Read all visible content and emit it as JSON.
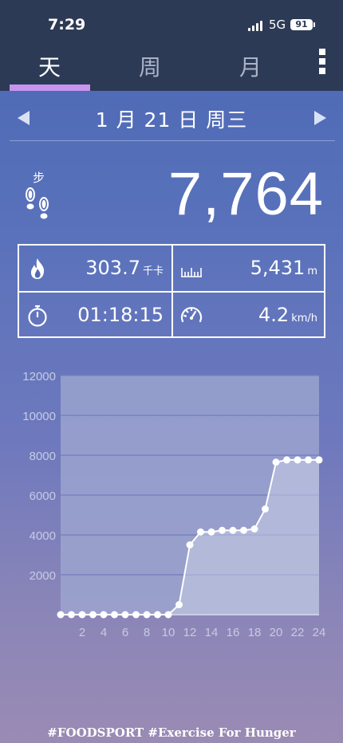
{
  "status_bar": {
    "time": "7:29",
    "network": "5G",
    "battery": "91"
  },
  "tabs": [
    {
      "label": "天",
      "active": true
    },
    {
      "label": "周",
      "active": false
    },
    {
      "label": "月",
      "active": false
    }
  ],
  "date": {
    "label": "1 月 21 日 周三"
  },
  "steps": {
    "label": "步",
    "value": "7,764"
  },
  "stats": {
    "calories": {
      "value": "303.7",
      "unit": "千卡",
      "icon": "flame-icon"
    },
    "distance": {
      "value": "5,431",
      "unit": "m",
      "icon": "ruler-icon"
    },
    "duration": {
      "value": "01:18:15",
      "icon": "stopwatch-icon"
    },
    "speed": {
      "value": "4.2",
      "unit": "km/h",
      "icon": "speedometer-icon"
    }
  },
  "chart_data": {
    "type": "line",
    "x": [
      0,
      1,
      2,
      3,
      4,
      5,
      6,
      7,
      8,
      9,
      10,
      11,
      12,
      13,
      14,
      15,
      16,
      17,
      18,
      19,
      20,
      21,
      22,
      23,
      24
    ],
    "values": [
      0,
      0,
      0,
      0,
      0,
      0,
      0,
      0,
      0,
      0,
      0,
      500,
      3500,
      4150,
      4150,
      4230,
      4230,
      4230,
      4300,
      5300,
      7650,
      7764,
      7764,
      7764,
      7764
    ],
    "y_ticks": [
      "2000",
      "4000",
      "6000",
      "8000",
      "10000",
      "12000"
    ],
    "x_ticks": [
      "2",
      "4",
      "6",
      "8",
      "10",
      "12",
      "14",
      "16",
      "18",
      "20",
      "22",
      "24"
    ],
    "xlim": [
      0,
      24
    ],
    "ylim": [
      0,
      12000
    ],
    "grid": true,
    "colors": {
      "line": "#ffffff",
      "fill": "#c9cde6",
      "plot_bg": "#9ea6d0",
      "grid": "#7882c0"
    }
  },
  "footer": {
    "text": "#FOODSPORT #Exercise For Hunger"
  }
}
